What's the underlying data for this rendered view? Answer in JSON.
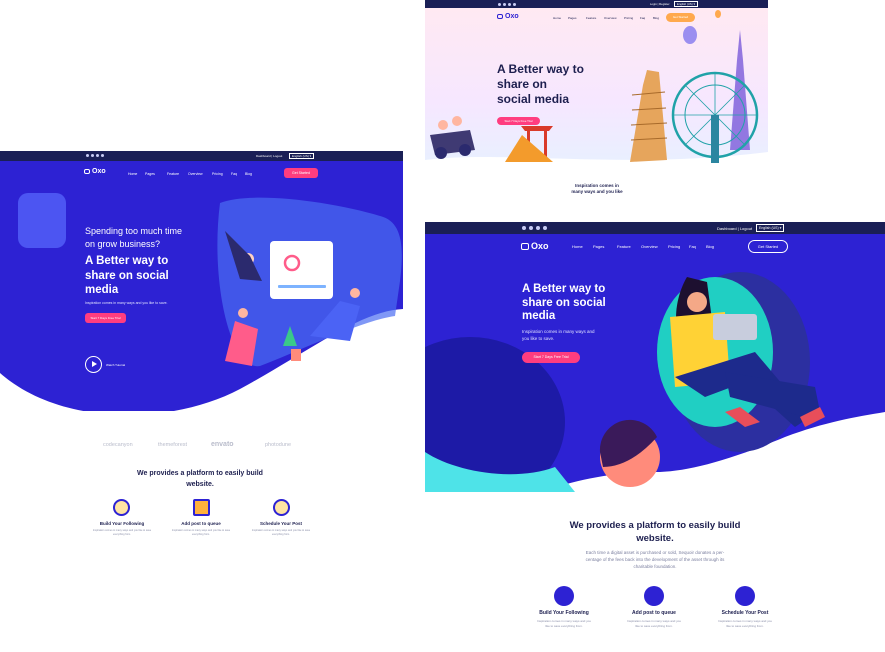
{
  "panel1": {
    "topbar": {
      "account": "Dashboard | Logout",
      "language": "English (US)"
    },
    "logo": "Oxo",
    "nav": [
      "Home",
      "Pages",
      "Feature",
      "Overview",
      "Pricing",
      "Faq",
      "Blog"
    ],
    "cta": "Get Started",
    "hero": {
      "kicker_line1": "Spending too much time",
      "kicker_line2": "on grow business?",
      "title_line1": "A Better way to",
      "title_line2": "share on social",
      "title_line3": "media",
      "subtitle": "Inspiration comes in many ways and you like to save.",
      "button": "Start 7 Days Free Trial",
      "video": "Watch Tutorial"
    },
    "brands": [
      "codecanyon",
      "themeforest",
      "envato",
      "photodune"
    ],
    "section_title_line1": "We provides a platform to easily build",
    "section_title_line2": "website.",
    "features": [
      {
        "title": "Build Your Following",
        "text": "Inspiration comes in many ways and you like to save everything from."
      },
      {
        "title": "Add post to queue",
        "text": "Inspiration comes in many ways and you like to save everything from."
      },
      {
        "title": "Schedule Your Post",
        "text": "Inspiration comes in many ways and you like to save everything from."
      }
    ]
  },
  "panel2": {
    "topbar": {
      "account": "Login | Register",
      "language": "English (US)"
    },
    "logo": "Oxo",
    "nav": [
      "Home",
      "Pages",
      "Feature",
      "Overview",
      "Pricing",
      "Faq",
      "Blog"
    ],
    "cta": "Get Started",
    "hero": {
      "title_line1": "A Better way to",
      "title_line2": "share on",
      "title_line3": "social media",
      "button": "Start 7 Days Free Trial"
    },
    "peek_line1": "Inspiration comes in",
    "peek_line2": "many ways and you like"
  },
  "panel3": {
    "topbar": {
      "account": "Dashboard | Logout",
      "language": "English (US)"
    },
    "logo": "Oxo",
    "nav": [
      "Home",
      "Pages",
      "Feature",
      "Overview",
      "Pricing",
      "Faq",
      "Blog"
    ],
    "cta": "Get Started",
    "hero": {
      "title_line1": "A Better way to",
      "title_line2": "share on social",
      "title_line3": "media",
      "subtitle_line1": "Inspiration comes in many ways and",
      "subtitle_line2": "you like to save.",
      "button": "Start 7 Days Free Trial"
    },
    "section_title_line1": "We provides a platform to easily build",
    "section_title_line2": "website.",
    "section_text_line1": "Each time a digital asset is purchased or sold, Sequoir donates a per-",
    "section_text_line2": "centage of the fees back into the development of the asset through its",
    "section_text_line3": "charitable foundation.",
    "features": [
      {
        "title": "Build Your Following",
        "text_line1": "Inspiration comes in many ways and you",
        "text_line2": "like to save everything from."
      },
      {
        "title": "Add post to queue",
        "text_line1": "Inspiration comes in many ways and you",
        "text_line2": "like to save everything from."
      },
      {
        "title": "Schedule Your Post",
        "text_line1": "Inspiration comes in many ways and you",
        "text_line2": "like to save everything from."
      }
    ]
  },
  "colors": {
    "primary": "#2d22d3",
    "navy": "#1a1f56",
    "accent_pink": "#ff3d7f",
    "heading": "#1d1f4f",
    "teal": "#4ee3e8",
    "salmon": "#ff8b7b"
  },
  "icons": [
    "twitter-icon",
    "linkedin-icon",
    "facebook-icon",
    "youtube-icon",
    "chevron-down-icon",
    "play-icon",
    "check-icon",
    "upload-icon",
    "clock-icon"
  ]
}
